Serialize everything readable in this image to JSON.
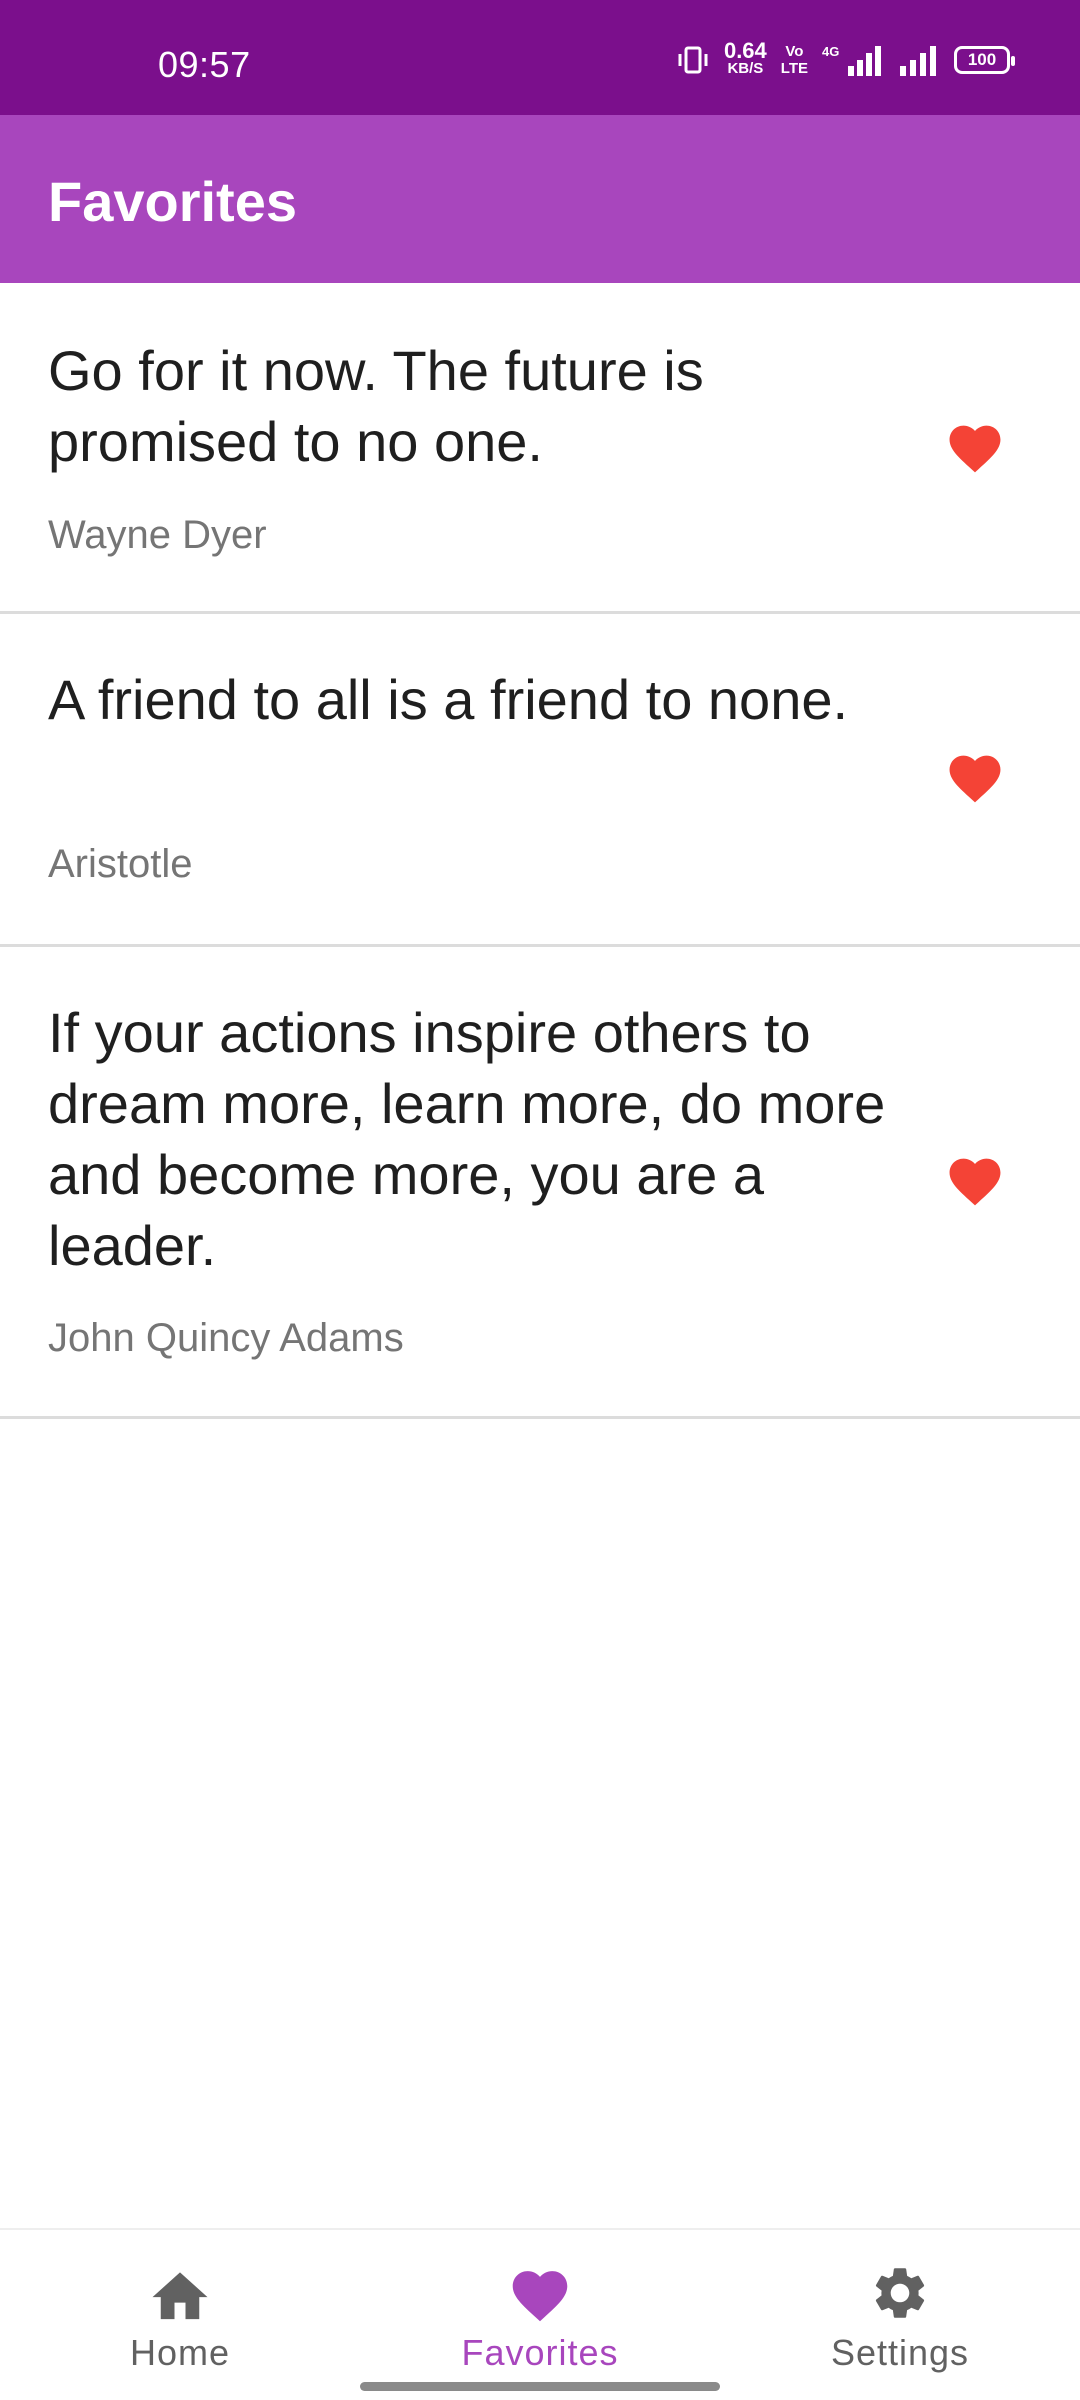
{
  "status_bar": {
    "time": "09:57",
    "net_speed_value": "0.64",
    "net_speed_unit": "KB/S",
    "volte_top": "Vo",
    "volte_bottom": "LTE",
    "network_type": "4G",
    "battery_level": "100"
  },
  "app_bar": {
    "title": "Favorites"
  },
  "quotes": [
    {
      "text": "Go for it now. The future is promised to no one.",
      "author": "Wayne Dyer",
      "favorite": true
    },
    {
      "text": "A friend to all is a friend to none.",
      "author": "Aristotle",
      "favorite": true
    },
    {
      "text": "If your actions inspire others to dream more, learn more, do more and become more, you are a leader.",
      "author": "John Quincy Adams",
      "favorite": true
    }
  ],
  "bottom_nav": {
    "items": [
      {
        "label": "Home",
        "icon": "home-icon",
        "active": false
      },
      {
        "label": "Favorites",
        "icon": "heart-icon",
        "active": true
      },
      {
        "label": "Settings",
        "icon": "gear-icon",
        "active": false
      }
    ]
  },
  "colors": {
    "status_bar": "#7b0f8c",
    "app_bar": "#a846bd",
    "heart": "#f44336",
    "active_nav": "#a846bd",
    "inactive_nav": "#616161"
  }
}
